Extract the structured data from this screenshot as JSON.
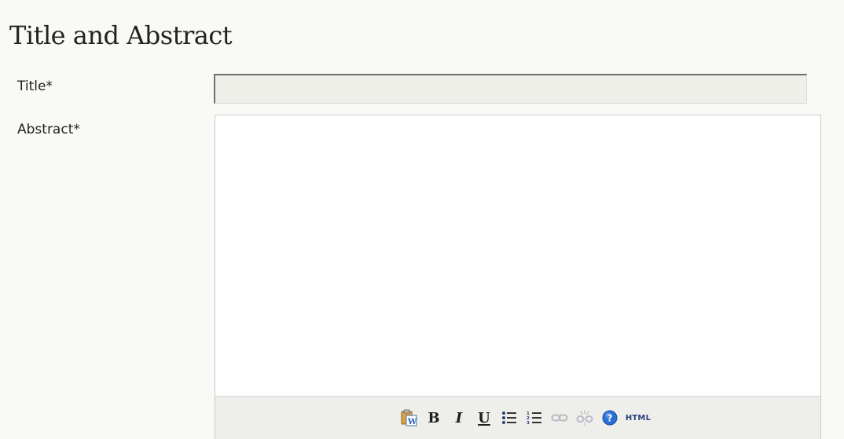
{
  "section": {
    "title": "Title and Abstract"
  },
  "fields": {
    "title": {
      "label": "Title*",
      "value": ""
    },
    "abstract": {
      "label": "Abstract*",
      "value": ""
    }
  },
  "toolbar": {
    "buttons": [
      {
        "name": "paste-from-word",
        "icon": "paste-from-word-icon"
      },
      {
        "name": "bold",
        "glyph": "B"
      },
      {
        "name": "italic",
        "glyph": "I"
      },
      {
        "name": "underline",
        "glyph": "U"
      },
      {
        "name": "bulleted-list",
        "icon": "bulleted-list-icon"
      },
      {
        "name": "numbered-list",
        "icon": "numbered-list-icon"
      },
      {
        "name": "insert-link",
        "icon": "link-icon"
      },
      {
        "name": "remove-link",
        "icon": "unlink-icon"
      },
      {
        "name": "help",
        "icon": "help-icon"
      },
      {
        "name": "html-source",
        "glyph": "HTML"
      }
    ],
    "colors": {
      "background": "#eeeeea",
      "help_blue": "#2a6fd6",
      "html_text": "#2c3e80"
    }
  }
}
